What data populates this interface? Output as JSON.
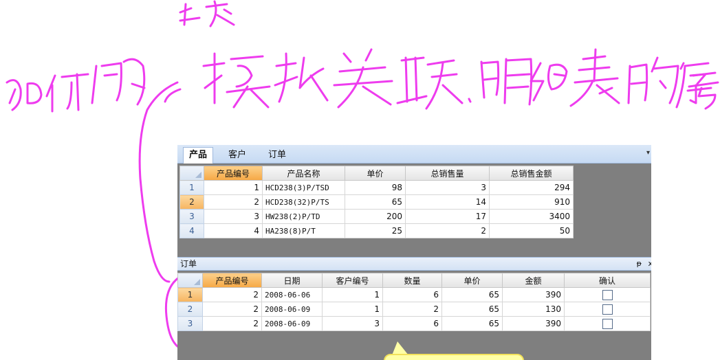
{
  "tabs": [
    {
      "label": "产品",
      "active": true
    },
    {
      "label": "客户",
      "active": false
    },
    {
      "label": "订单",
      "active": false
    }
  ],
  "products": {
    "columns": [
      "产品编号",
      "产品名称",
      "单价",
      "总销售量",
      "总销售金额"
    ],
    "rows": [
      {
        "no": "1",
        "cells": [
          "1",
          "HCD238(3)P/TSD",
          "98",
          "3",
          "294"
        ]
      },
      {
        "no": "2",
        "cells": [
          "2",
          "HCD238(32)P/TS",
          "65",
          "14",
          "910"
        ]
      },
      {
        "no": "3",
        "cells": [
          "3",
          "HW238(2)P/TD",
          "200",
          "17",
          "3400"
        ]
      },
      {
        "no": "4",
        "cells": [
          "4",
          "HA238(8)P/T",
          "25",
          "2",
          "50"
        ]
      }
    ],
    "current_row": 2
  },
  "orders_panel": {
    "title": "订单",
    "pin_glyph": "ᵽ",
    "close_glyph": "x"
  },
  "orders": {
    "columns": [
      "产品编号",
      "日期",
      "客户编号",
      "数量",
      "单价",
      "金额",
      "确认"
    ],
    "rows": [
      {
        "no": "1",
        "cells": [
          "2",
          "2008-06-06",
          "1",
          "6",
          "65",
          "390"
        ],
        "confirmed": false
      },
      {
        "no": "2",
        "cells": [
          "2",
          "2008-06-09",
          "1",
          "2",
          "65",
          "130"
        ],
        "confirmed": false
      },
      {
        "no": "3",
        "cells": [
          "2",
          "2008-06-09",
          "3",
          "6",
          "65",
          "390"
        ],
        "confirmed": false
      }
    ],
    "current_row": 1
  },
  "colors": {
    "annotation_ink": "#ee3cee",
    "sorted_header": "#f6a845",
    "tooltip_bg": "#ffffa6"
  },
  "icons": {
    "pin": "pin-icon",
    "close": "close-icon",
    "checkbox": "checkbox-icon",
    "menu_arrow": "chevron-down-icon"
  }
}
